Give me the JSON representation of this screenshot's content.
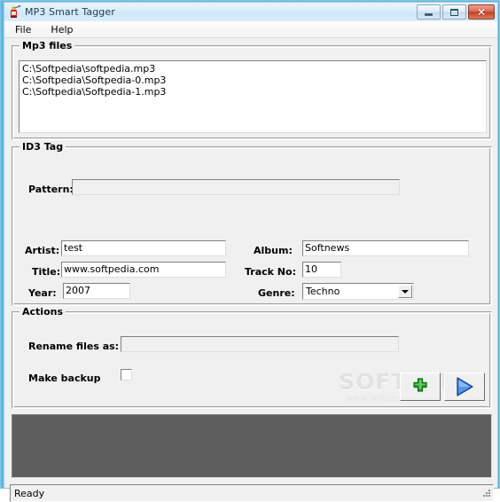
{
  "window": {
    "title": "MP3 Smart Tagger",
    "icon": "app-icon",
    "controls": {
      "minimize": "–",
      "maximize": "□",
      "close": "✕"
    }
  },
  "menubar": {
    "items": [
      {
        "label": "File"
      },
      {
        "label": "Help"
      }
    ]
  },
  "mp3_files": {
    "group_label": "Mp3 files",
    "files": [
      "C:\\Softpedia\\softpedia.mp3",
      "C:\\Softpedia\\Softpedia-0.mp3",
      "C:\\Softpedia\\Softpedia-1.mp3"
    ]
  },
  "id3_tag": {
    "group_label": "ID3 Tag",
    "pattern": {
      "label": "Pattern:",
      "value": "",
      "placeholder": "",
      "disabled": true
    },
    "artist": {
      "label": "Artist:",
      "value": "test"
    },
    "title": {
      "label": "Title:",
      "value": "www.softpedia.com"
    },
    "year": {
      "label": "Year:",
      "value": "2007"
    },
    "album": {
      "label": "Album:",
      "value": "Softnews"
    },
    "track_no": {
      "label": "Track No:",
      "value": "10"
    },
    "genre": {
      "label": "Genre:",
      "value": "Techno"
    }
  },
  "actions": {
    "group_label": "Actions",
    "rename": {
      "label": "Rename files as:",
      "value": "",
      "disabled": true
    },
    "make_backup": {
      "label": "Make backup",
      "checked": false
    },
    "add_button": {
      "icon": "green-plus-icon"
    },
    "run_button": {
      "icon": "blue-play-icon"
    }
  },
  "watermark": {
    "main": "SOFTPEDIA",
    "sub": "www.softpedia.com"
  },
  "log_panel": {
    "content": ""
  },
  "statusbar": {
    "text": "Ready"
  },
  "colors": {
    "frame": "#5bb8e8",
    "titlebar": "#dceefa",
    "panel": "#f0f0f0",
    "log": "#5e5e5e",
    "close_button": "#c33f24",
    "plus_green": "#1a8a1a",
    "play_blue": "#1b5fd0"
  }
}
